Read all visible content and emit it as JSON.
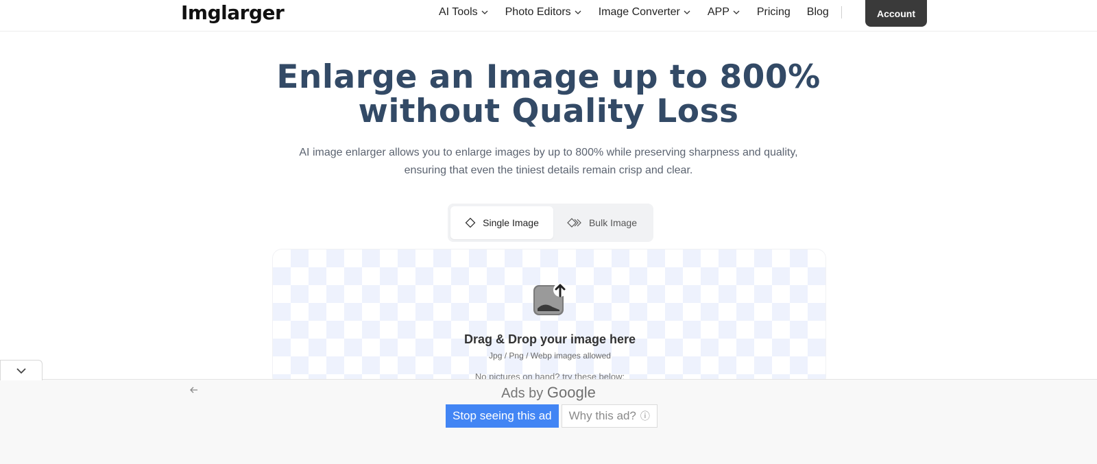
{
  "header": {
    "logo": "Imglarger",
    "nav": [
      {
        "label": "AI Tools",
        "has_dropdown": true
      },
      {
        "label": "Photo Editors",
        "has_dropdown": true
      },
      {
        "label": "Image Converter",
        "has_dropdown": true
      },
      {
        "label": "APP",
        "has_dropdown": true
      },
      {
        "label": "Pricing",
        "has_dropdown": false
      },
      {
        "label": "Blog",
        "has_dropdown": false
      }
    ],
    "account_label": "Account"
  },
  "hero": {
    "title_line1": "Enlarge an Image up to 800%",
    "title_line2": "without Quality Loss",
    "subtitle_line1": "AI image enlarger allows you to enlarge images by up to 800% while preserving sharpness and quality,",
    "subtitle_line2": "ensuring that even the tiniest details remain crisp and clear."
  },
  "tabs": {
    "single": "Single Image",
    "bulk": "Bulk Image",
    "active": "single"
  },
  "dropzone": {
    "title": "Drag & Drop your image here",
    "hint": "Jpg / Png / Webp images allowed",
    "more": "No pictures on hand? try these below:"
  },
  "ad": {
    "ads_by": "Ads by",
    "google": "Google",
    "stop_label": "Stop seeing this ad",
    "why_label": "Why this ad?",
    "why_icon": "ⓘ"
  },
  "colors": {
    "title": "#334a66",
    "account_bg": "#3a3a3a",
    "stop_btn": "#4285f4",
    "checker": "#eef2fd"
  }
}
